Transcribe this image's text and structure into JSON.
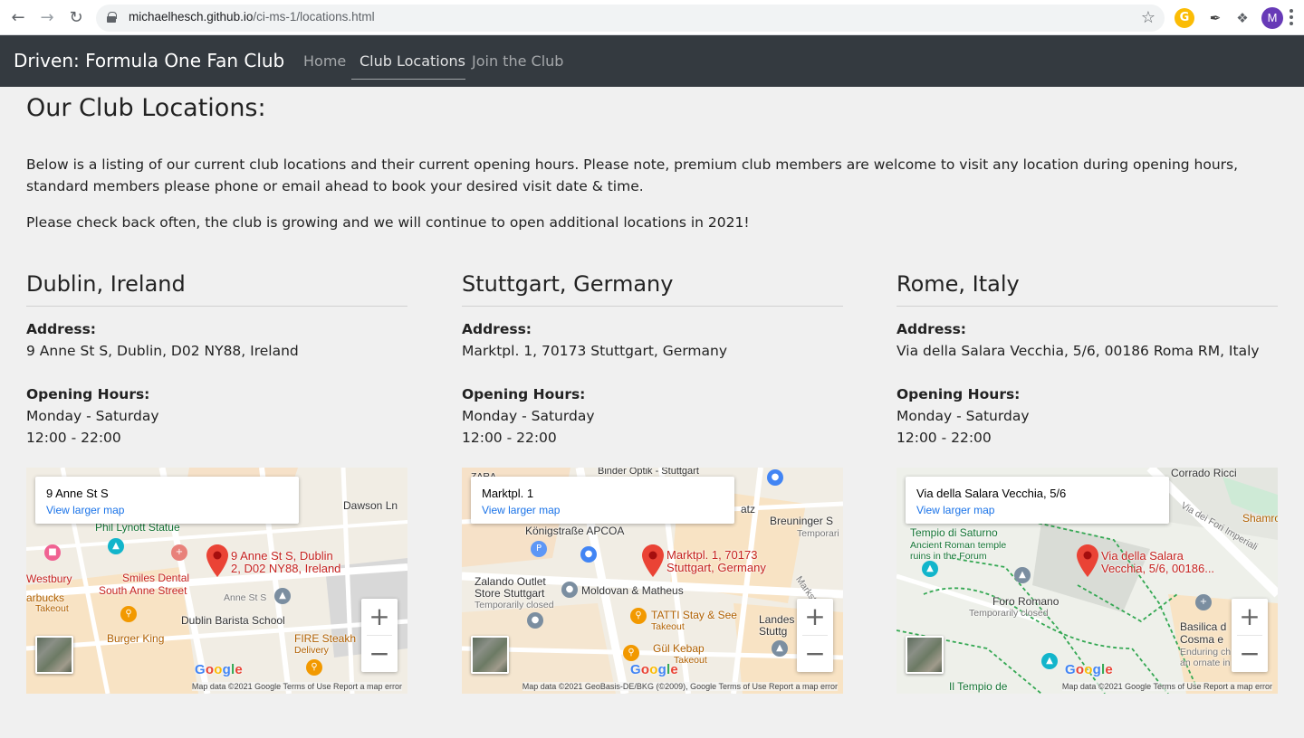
{
  "browser": {
    "url_domain": "michaelhesch.github.io",
    "url_path": "/ci-ms-1/locations.html",
    "avatar_letter": "M",
    "ext_letter": "G"
  },
  "navbar": {
    "brand": "Driven: Formula One Fan Club",
    "links": [
      "Home",
      "Club Locations",
      "Join the Club"
    ],
    "active": "Club Locations"
  },
  "main": {
    "title": "Our Club Locations:",
    "intro": "Below is a listing of our current club locations and their current opening hours. Please note, premium club members are welcome to visit any location during opening hours, standard members please phone or email ahead to book your desired visit date & time.",
    "intro2": "Please check back often, the club is growing and we will continue to open additional locations in 2021!"
  },
  "labels": {
    "address": "Address:",
    "hours": "Opening Hours:"
  },
  "locations": [
    {
      "city": "Dublin, Ireland",
      "address": "9 Anne St S, Dublin, D02 NY88, Ireland",
      "days": "Monday - Saturday",
      "time": "12:00 - 22:00",
      "map": {
        "card_title": "9 Anne St S",
        "link": "View larger map",
        "pin_label_1": "9 Anne St S, Dublin",
        "pin_label_2": "2, D02 NY88, Ireland",
        "attribution": "Map data ©2021 Google    Terms of Use    Report a map error",
        "pois": [
          "Dawson Ln",
          "Phil Lynott Statue",
          "Westbury",
          "Smiles Dental",
          "South Anne Street",
          "Anne St S",
          "arbucks",
          "Takeout",
          "Dublin Barista School",
          "Burger King",
          "FIRE Steakh",
          "Delivery"
        ]
      }
    },
    {
      "city": "Stuttgart, Germany",
      "address": "Marktpl. 1, 70173 Stuttgart, Germany",
      "days": "Monday - Saturday",
      "time": "12:00 - 22:00",
      "map": {
        "card_title": "Marktpl. 1",
        "link": "View larger map",
        "pin_label_1": "Marktpl. 1, 70173",
        "pin_label_2": "Stuttgart, Germany",
        "attribution": "Map data ©2021 GeoBasis-DE/BKG (©2009), Google    Terms of Use    Report a map error",
        "pois": [
          "Königstraße APCOA",
          "Breuninger S",
          "Temporari",
          "Zalando Outlet",
          "Store Stuttgart",
          "Temporarily closed",
          "Moldovan & Matheus",
          "TATTI Stay & See",
          "Takeout",
          "Gül Kebap",
          "Takeout",
          "Markstraße",
          "Landes",
          "Stuttg",
          "ZARA",
          "Binder Optik - Stuttgart",
          "atz"
        ]
      }
    },
    {
      "city": "Rome, Italy",
      "address": "Via della Salara Vecchia, 5/6, 00186 Roma RM, Italy",
      "days": "Monday - Saturday",
      "time": "12:00 - 22:00",
      "map": {
        "card_title": "Via della Salara Vecchia, 5/6",
        "link": "View larger map",
        "pin_label_1": "Via della Salara",
        "pin_label_2": "Vecchia, 5/6, 00186...",
        "attribution": "Map data ©2021 Google    Terms of Use    Report a map error",
        "pois": [
          "Corrado Ricci",
          "Tempio di Saturno",
          "Ancient Roman temple",
          "ruins in the Forum",
          "Foro Romano",
          "Temporarily closed",
          "Basilica d",
          "Cosma e",
          "Enduring ch",
          "an ornate in",
          "Shamroc",
          "Via dei Fori Imperiali",
          "Il Tempio de"
        ]
      }
    }
  ],
  "colors": {
    "navbar_bg": "#343a40",
    "page_bg": "#f0f0f0",
    "pin_red": "#ea4335",
    "link_blue": "#1a73e8"
  }
}
